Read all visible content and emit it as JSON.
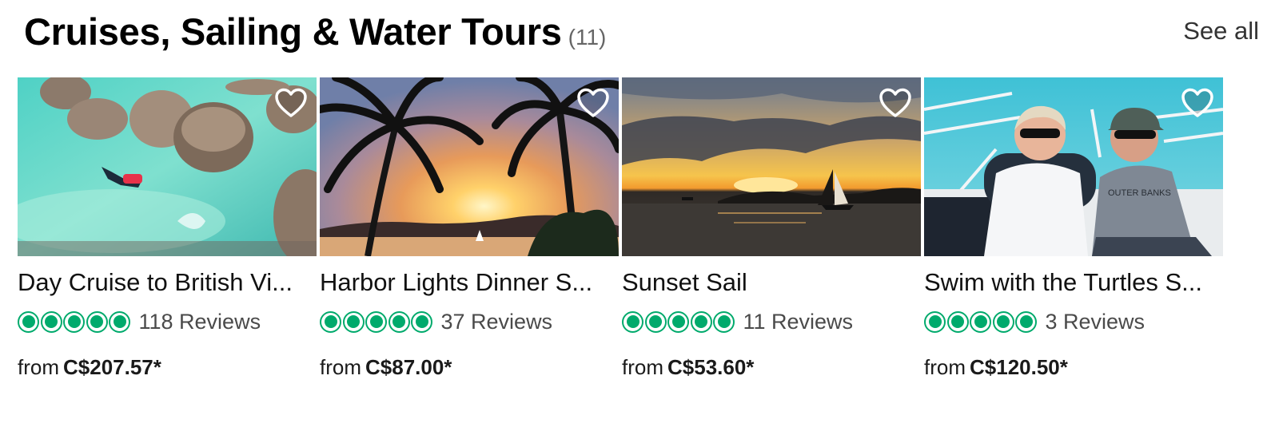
{
  "section": {
    "title": "Cruises, Sailing & Water Tours",
    "count": "(11)",
    "see_all": "See all"
  },
  "cards": [
    {
      "title": "Day Cruise to British Vi...",
      "rating": 5,
      "reviews": "118 Reviews",
      "price_prefix": "from",
      "price": "C$207.57*",
      "photo": "snorkeler-among-boulders"
    },
    {
      "title": "Harbor Lights Dinner S...",
      "rating": 5,
      "reviews": "37 Reviews",
      "price_prefix": "from",
      "price": "C$87.00*",
      "photo": "palm-trees-sunset"
    },
    {
      "title": "Sunset Sail",
      "rating": 5,
      "reviews": "11 Reviews",
      "price_prefix": "from",
      "price": "C$53.60*",
      "photo": "sailboat-sunset"
    },
    {
      "title": "Swim with the Turtles S...",
      "rating": 5,
      "reviews": "3 Reviews",
      "price_prefix": "from",
      "price": "C$120.50*",
      "photo": "couple-on-boat"
    }
  ],
  "icons": {
    "save": "heart-outline-icon",
    "rating": "rating-bubble-icon"
  },
  "colors": {
    "rating": "#00aa6c",
    "title": "#000000",
    "text": "#1a1a1a",
    "muted": "#4a4a4a"
  }
}
